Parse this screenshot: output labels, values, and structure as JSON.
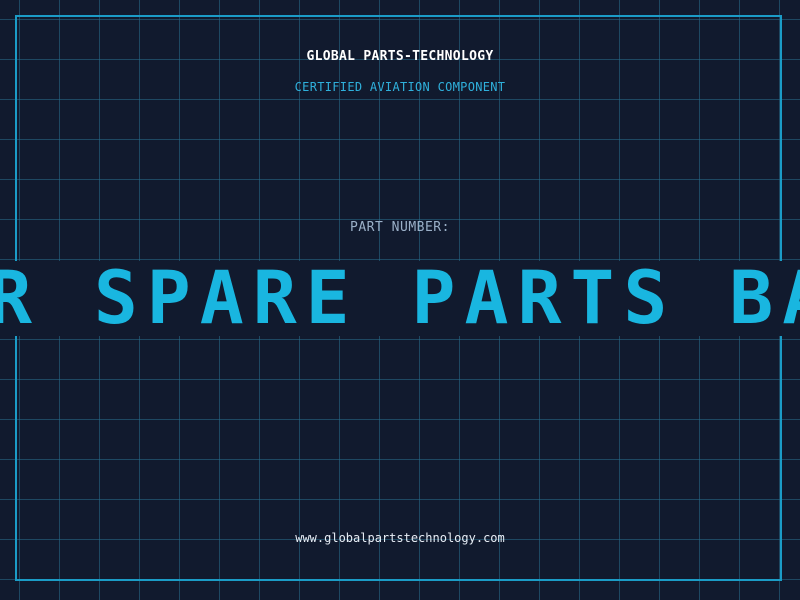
{
  "header": {
    "brand": "GLOBAL PARTS-TECHNOLOGY",
    "tagline": "CERTIFIED AVIATION COMPONENT"
  },
  "part": {
    "label": "PART NUMBER:",
    "value": "ER SPARE PARTS BATT"
  },
  "footer": {
    "website": "www.globalpartstechnology.com"
  },
  "colors": {
    "background": "#111a2e",
    "accent": "#19b6e0",
    "frame": "#1b9cc7"
  }
}
